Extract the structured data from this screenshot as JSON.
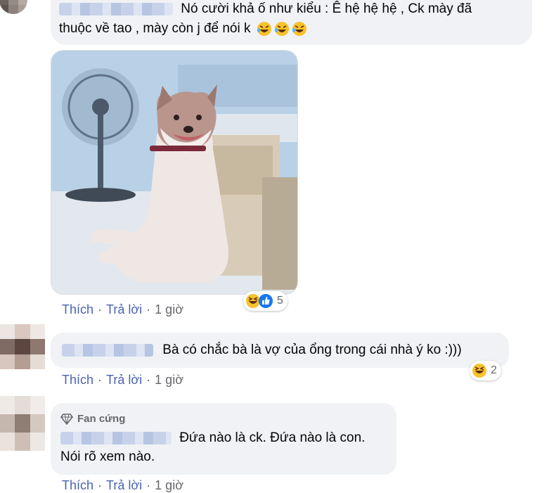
{
  "comments": [
    {
      "text_line1": "Nó cười khả ố như kiểu : Ê hệ hệ hệ , Ck mày đã",
      "text_line2": "thuộc về tao , mày còn j để nói k",
      "emoji_icons": [
        "rofl-emoji-icon",
        "rofl-emoji-icon",
        "rofl-emoji-icon"
      ],
      "actions": {
        "like": "Thích",
        "reply": "Trả lời",
        "time": "1 giờ"
      },
      "reactions": {
        "icons": [
          "haha-icon",
          "like-icon"
        ],
        "count": "5"
      }
    },
    {
      "text": "Bà có chắc bà là vợ của ổng trong cái nhà ý ko :)))",
      "actions": {
        "like": "Thích",
        "reply": "Trả lời",
        "time": "1 giờ"
      },
      "reactions": {
        "icons": [
          "haha-icon"
        ],
        "count": "2"
      }
    },
    {
      "badge": "Fan cứng",
      "text_line1": "Đứa nào là ck. Đứa nào là con.",
      "text_line2": "Nói rõ xem nào.",
      "actions": {
        "like": "Thích",
        "reply": "Trả lời",
        "time": "1 giờ"
      }
    }
  ],
  "colors": {
    "bubble": "#f0f2f5",
    "action_link": "#4a63b3",
    "meta_text": "#65676b",
    "like_blue": "#1877f2",
    "haha_yellow": "#f7c22d"
  }
}
